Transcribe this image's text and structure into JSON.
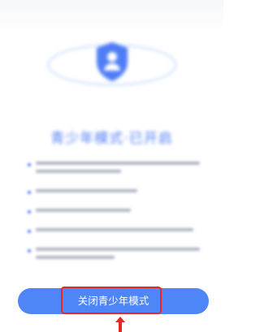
{
  "background": {
    "title": "青少年模式·已开启",
    "bullet_lines": [
      2,
      1,
      1,
      1,
      2
    ]
  },
  "close_button": {
    "label": "关闭青少年模式"
  },
  "colors": {
    "accent": "#4f86f7",
    "title": "#4f7cf5",
    "highlight": "#e8271f"
  },
  "icons": {
    "emblem": "shield-user-icon",
    "annotation": "arrow-up-icon"
  }
}
